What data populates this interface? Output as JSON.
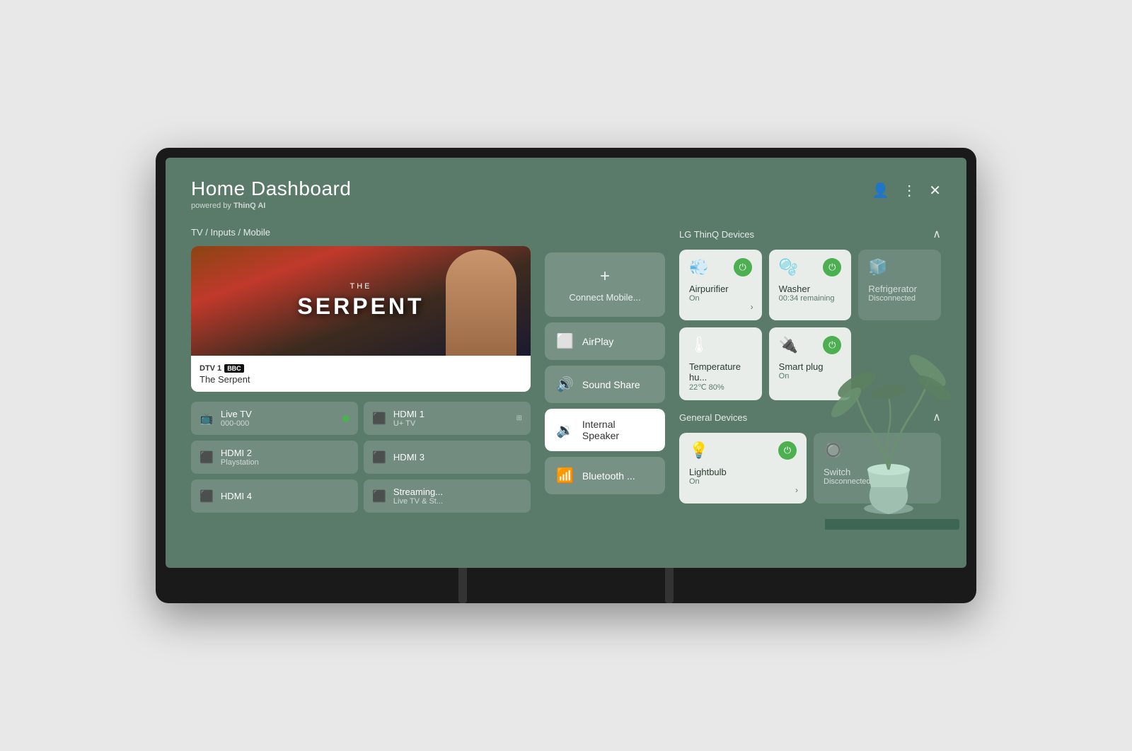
{
  "header": {
    "title": "Home Dashboard",
    "subtitle_prefix": "powered by ",
    "subtitle_brand": "ThinQ AI",
    "icons": {
      "user": "👤",
      "menu": "⋮",
      "close": "✕"
    }
  },
  "tv_section": {
    "label": "TV / Inputs / Mobile",
    "current_channel": "DTV 1",
    "current_show": "The Serpent",
    "show_display": "THE\nSERPENT",
    "bbc_text": "BBC",
    "inputs": [
      {
        "name": "Live TV",
        "sub": "000-000",
        "active": true,
        "icon": "📺"
      },
      {
        "name": "HDMI 1",
        "sub": "U+ TV",
        "active": false,
        "icon": "📡"
      },
      {
        "name": "HDMI 2",
        "sub": "Playstation",
        "active": false,
        "icon": "📡"
      },
      {
        "name": "HDMI 3",
        "sub": "",
        "active": false,
        "icon": "📡"
      },
      {
        "name": "HDMI 4",
        "sub": "",
        "active": false,
        "icon": "📡"
      },
      {
        "name": "Streaming...",
        "sub": "Live TV & St...",
        "active": false,
        "icon": "📡"
      }
    ]
  },
  "audio_section": {
    "connect_label": "Connect Mobile...",
    "airplay_label": "AirPlay",
    "sound_share_label": "Sound Share",
    "internal_speaker_label": "Internal Speaker",
    "bluetooth_label": "Bluetooth ..."
  },
  "thinq_section": {
    "label": "LG ThinQ Devices",
    "devices": [
      {
        "name": "Airpurifier",
        "status": "On",
        "icon": "💨",
        "power": true,
        "disconnected": false,
        "has_arrow": true
      },
      {
        "name": "Washer",
        "status": "00:34 remaining",
        "icon": "🫧",
        "power": true,
        "disconnected": false,
        "has_arrow": false
      },
      {
        "name": "Refrigerator",
        "status": "Disconnected",
        "icon": "🧊",
        "power": false,
        "disconnected": true,
        "has_arrow": false
      },
      {
        "name": "Temperature hu...",
        "status": "22℃ 80%",
        "icon": "🌡",
        "power": false,
        "disconnected": false,
        "has_arrow": false
      },
      {
        "name": "Smart plug",
        "status": "On",
        "icon": "🔌",
        "power": true,
        "disconnected": false,
        "has_arrow": false
      }
    ]
  },
  "general_section": {
    "label": "General Devices",
    "devices": [
      {
        "name": "Lightbulb",
        "status": "On",
        "icon": "💡",
        "power": true,
        "disconnected": false,
        "has_arrow": true
      },
      {
        "name": "Switch",
        "status": "Disconnected",
        "icon": "🔌",
        "power": false,
        "disconnected": true,
        "has_arrow": false
      }
    ]
  }
}
